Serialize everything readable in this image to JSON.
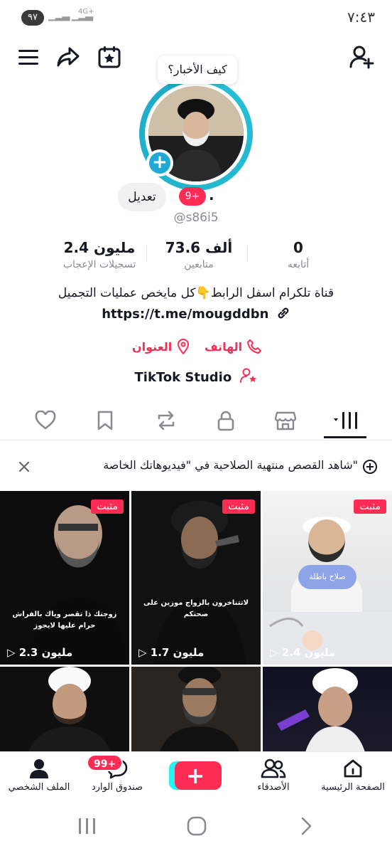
{
  "status_bar": {
    "time": "٧:٤٣",
    "battery": "٩٧",
    "network": "4G+"
  },
  "header": {
    "add_friend_icon": "person-plus-icon",
    "calendar_icon": "calendar-star-icon",
    "share_icon": "share-arrow-icon",
    "menu_icon": "hamburger-menu-icon"
  },
  "profile": {
    "bubble_text": "كيف الأخبار؟",
    "edit_label": "تعديل",
    "notification_badge": "9+",
    "name_dot": ".",
    "username": "@s86i5",
    "stats": [
      {
        "value": "0",
        "label": "أتابعه"
      },
      {
        "value": "73.6 ألف",
        "label": "متابعين"
      },
      {
        "value": "2.4 مليون",
        "label": "تسجيلات الإعجاب"
      }
    ],
    "bio": "قناة تلكرام اسفل الرابط👇كل مايخص عمليات التجميل",
    "link": "https://t.me/mougddbn",
    "phone_label": "الهاتف",
    "address_label": "العنوان",
    "studio_label": "TikTok Studio"
  },
  "tabs": [
    "videos-grid",
    "private-lock",
    "repost",
    "favorites-bookmark",
    "liked-heart",
    "shop"
  ],
  "banner": {
    "text": "شاهد القصص منتهية الصلاحية في \"فيديوهاتك الخاصة\""
  },
  "videos": [
    {
      "pinned": "مثبت",
      "views": "2.4 مليون",
      "caption": "",
      "badge": "صلاح باطلة"
    },
    {
      "pinned": "مثبت",
      "views": "1.7 مليون",
      "caption": "لاتتناخرون بالزواج موزين على صحتكم",
      "badge": ""
    },
    {
      "pinned": "مثبت",
      "views": "2.3 مليون",
      "caption": "زوجتك ذا تقصر وياك بالفراش حرام عليها لايجوز",
      "badge": ""
    },
    {
      "pinned": "",
      "views": "",
      "caption": "",
      "badge": ""
    },
    {
      "pinned": "",
      "views": "",
      "caption": "",
      "badge": ""
    },
    {
      "pinned": "",
      "views": "",
      "caption": "",
      "badge": ""
    }
  ],
  "bottom_nav": {
    "home": "الصفحة الرئيسية",
    "friends": "الأصدقاء",
    "create_icon": "plus-icon",
    "inbox": "صندوق الوارد",
    "inbox_badge": "99+",
    "profile": "الملف الشخصي"
  },
  "colors": {
    "accent": "#fe2c55",
    "ring": "#20a9c6",
    "text": "#161823",
    "muted": "#8a8b91"
  }
}
